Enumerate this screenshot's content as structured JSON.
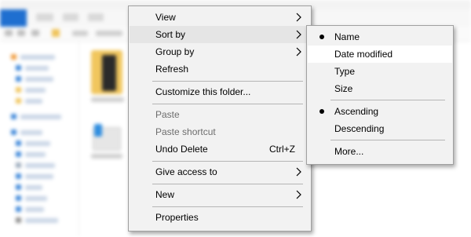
{
  "context_menu": {
    "items": [
      {
        "label": "View",
        "has_submenu": true
      },
      {
        "label": "Sort by",
        "has_submenu": true,
        "highlighted": true
      },
      {
        "label": "Group by",
        "has_submenu": true
      },
      {
        "label": "Refresh"
      },
      {
        "label": "Customize this folder..."
      },
      {
        "label": "Paste",
        "disabled": true
      },
      {
        "label": "Paste shortcut",
        "disabled": true
      },
      {
        "label": "Undo Delete",
        "shortcut": "Ctrl+Z"
      },
      {
        "label": "Give access to",
        "has_submenu": true
      },
      {
        "label": "New",
        "has_submenu": true
      },
      {
        "label": "Properties"
      }
    ]
  },
  "sort_submenu": {
    "items": [
      {
        "label": "Name",
        "checked": true
      },
      {
        "label": "Date modified",
        "highlighted": true
      },
      {
        "label": "Type"
      },
      {
        "label": "Size"
      },
      {
        "label": "Ascending",
        "checked": true
      },
      {
        "label": "Descending"
      },
      {
        "label": "More..."
      }
    ]
  },
  "icons": {
    "submenu_arrow": "chevron-right-icon",
    "selection_bullet": "bullet-icon"
  },
  "colors": {
    "menu_bg": "#f2f2f2",
    "menu_border": "#a0a0a0",
    "highlight": "#e5e5e5",
    "disabled_text": "#6d6d6d",
    "explorer_accent": "#1f6fd0"
  }
}
